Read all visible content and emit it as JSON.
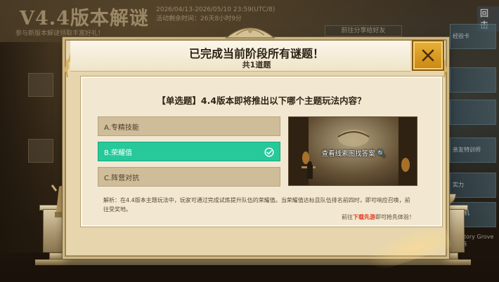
{
  "background": {
    "title": "V4.4版本解谜",
    "dates": "2026/04/13-2026/05/10 23:59(UTC/8)",
    "remaining": "活动剩余时间：26天8小时9分",
    "subtitle": "参与新版本解谜领取丰富好礼！",
    "top_right": "回击",
    "tab_label": "前往分享给好友",
    "side_items": [
      "经验卡",
      "",
      "",
      "",
      "亲友特训师",
      "",
      "实力",
      "",
      "团战机"
    ],
    "bottom_right": "Victory Grove宝箱"
  },
  "modal": {
    "title": "已完成当前阶段所有谜题！",
    "count_text": "共1道题",
    "close_icon": "close-icon",
    "question": "【单选题】4.4版本即将推出以下哪个主题玩法内容？",
    "options": [
      {
        "label": "A.专精技能",
        "selected": false
      },
      {
        "label": "B.荣耀值",
        "selected": true
      },
      {
        "label": "C.阵营对抗",
        "selected": false
      }
    ],
    "clue_text": "查看线索图找答案 🔍",
    "explanation": "解析：在4.4版本主题玩法中，玩家可通过完成试炼提升队伍的荣耀值。当荣耀值达标且队伍排名前四时，即可响应召唤，前往受奖地。",
    "footer_prefix": "前往",
    "footer_link": "下载先游",
    "footer_suffix": "即可抢先体验！"
  },
  "colors": {
    "selected_option": "#27c99b",
    "close_button": "#e0a22a",
    "link": "#e23a1e"
  }
}
